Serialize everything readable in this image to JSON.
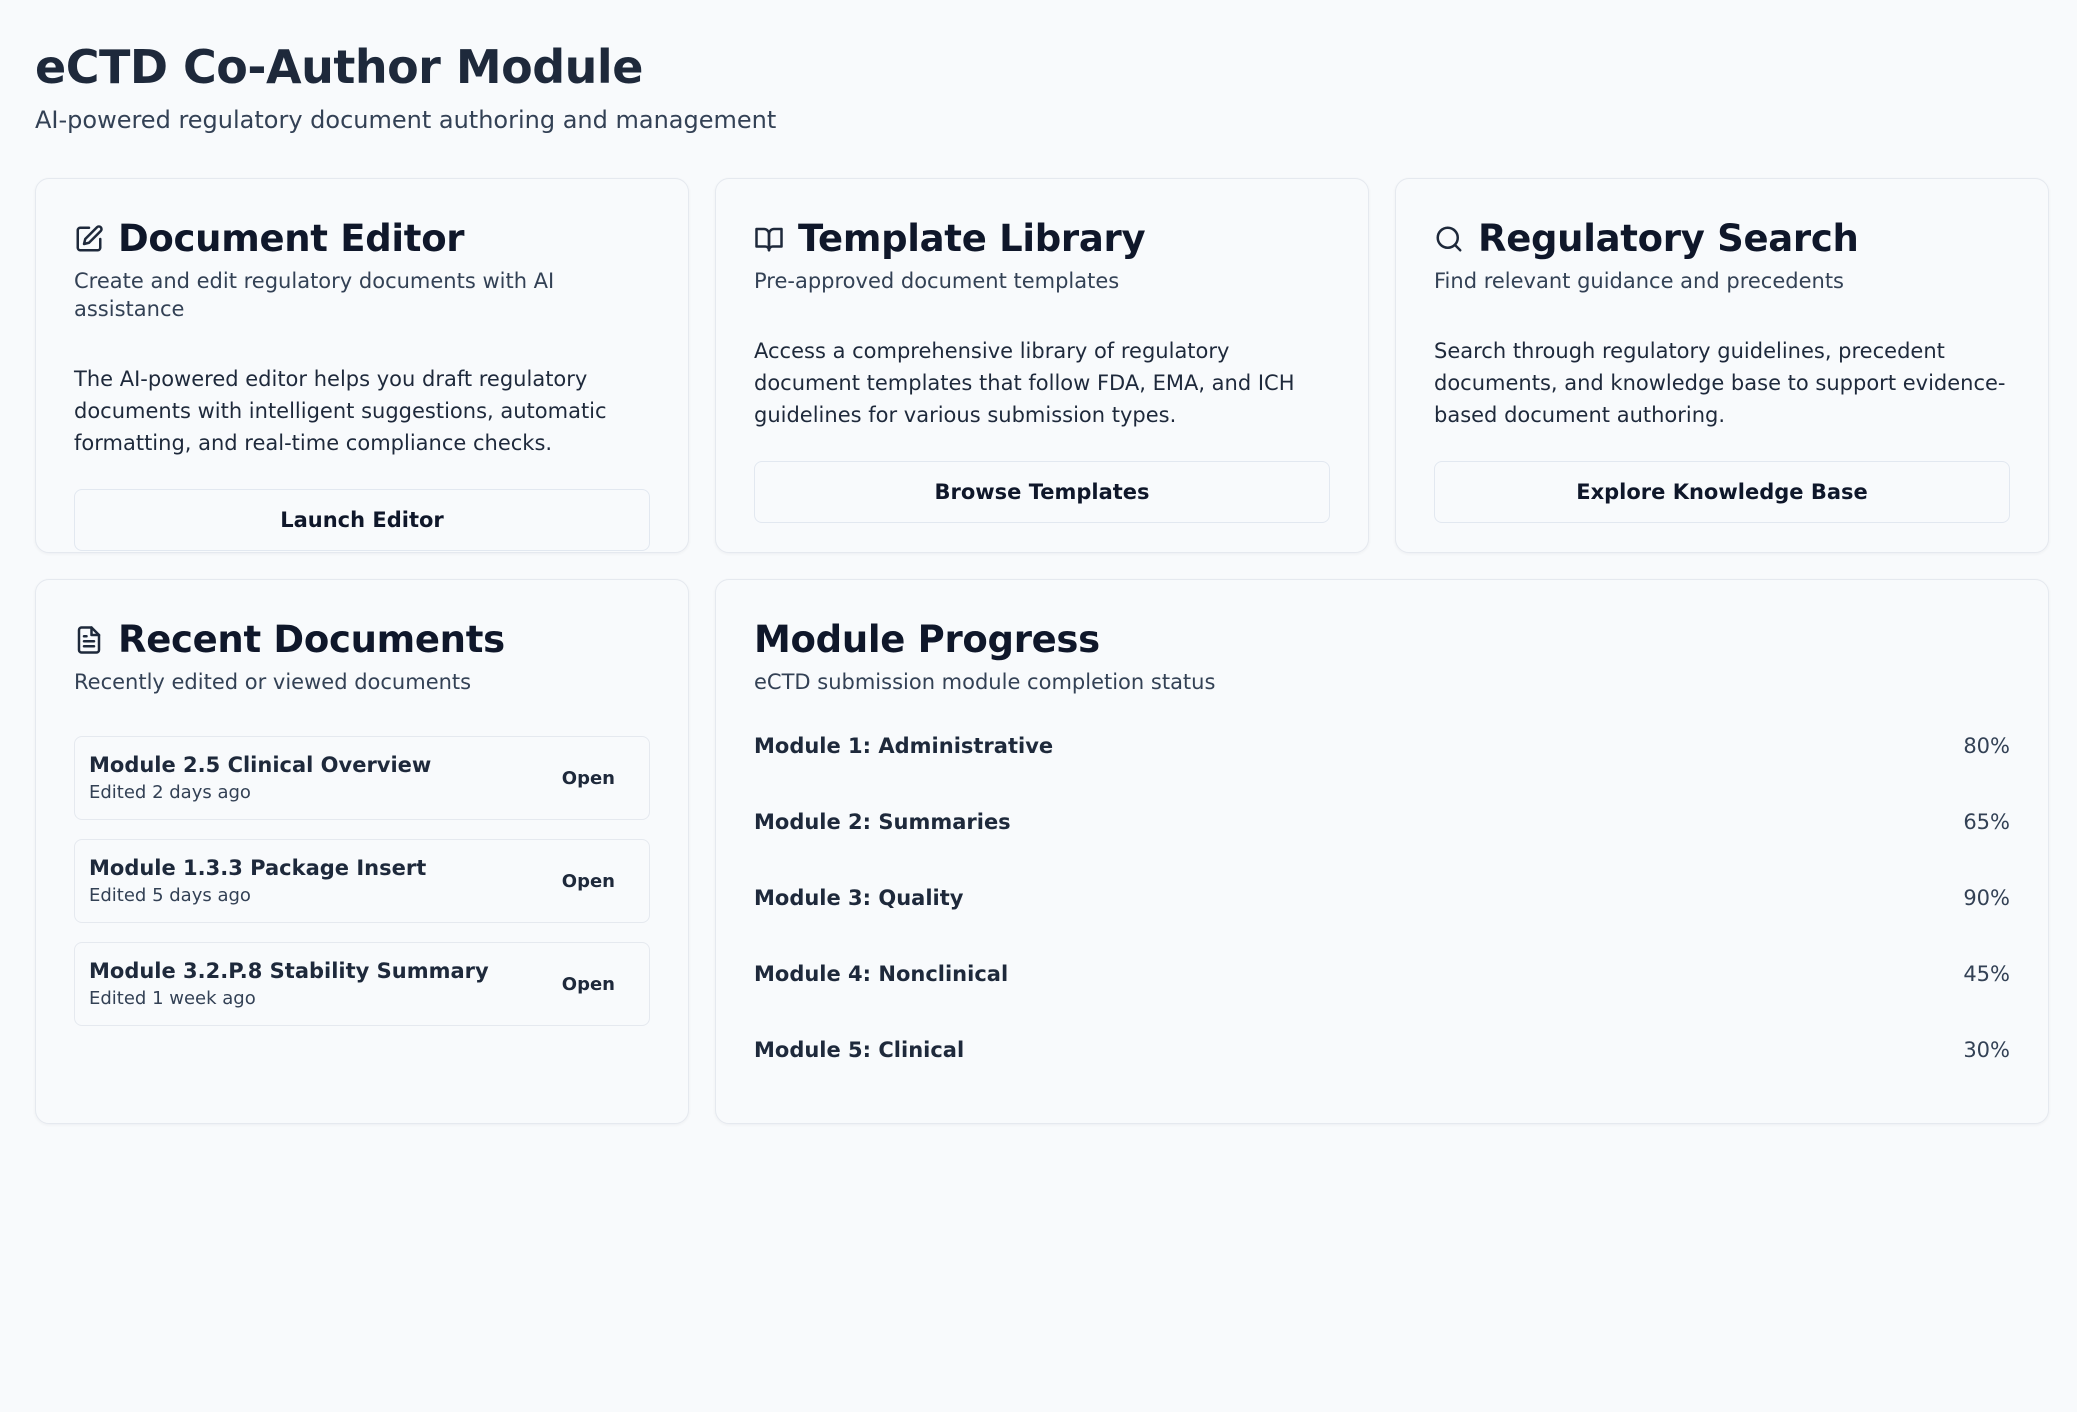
{
  "header": {
    "title": "eCTD Co-Author Module",
    "subtitle": "AI-powered regulatory document authoring and management"
  },
  "cards": [
    {
      "icon": "edit-icon",
      "title": "Document Editor",
      "description": "Create and edit regulatory documents with AI assistance",
      "body": "The AI-powered editor helps you draft regulatory documents with intelligent suggestions, automatic formatting, and real-time compliance checks.",
      "button_label": "Launch Editor"
    },
    {
      "icon": "book-open-icon",
      "title": "Template Library",
      "description": "Pre-approved document templates",
      "body": "Access a comprehensive library of regulatory document templates that follow FDA, EMA, and ICH guidelines for various submission types.",
      "button_label": "Browse Templates"
    },
    {
      "icon": "search-icon",
      "title": "Regulatory Search",
      "description": "Find relevant guidance and precedents",
      "body": "Search through regulatory guidelines, precedent documents, and knowledge base to support evidence-based document authoring.",
      "button_label": "Explore Knowledge Base"
    }
  ],
  "recent": {
    "icon": "file-text-icon",
    "title": "Recent Documents",
    "description": "Recently edited or viewed documents",
    "items": [
      {
        "name": "Module 2.5 Clinical Overview",
        "meta": "Edited 2 days ago",
        "action": "Open"
      },
      {
        "name": "Module 1.3.3 Package Insert",
        "meta": "Edited 5 days ago",
        "action": "Open"
      },
      {
        "name": "Module 3.2.P.8 Stability Summary",
        "meta": "Edited 1 week ago",
        "action": "Open"
      }
    ]
  },
  "progress": {
    "title": "Module Progress",
    "description": "eCTD submission module completion status",
    "modules": [
      {
        "label": "Module 1: Administrative",
        "value": "80%"
      },
      {
        "label": "Module 2: Summaries",
        "value": "65%"
      },
      {
        "label": "Module 3: Quality",
        "value": "90%"
      },
      {
        "label": "Module 4: Nonclinical",
        "value": "45%"
      },
      {
        "label": "Module 5: Clinical",
        "value": "30%"
      }
    ]
  }
}
